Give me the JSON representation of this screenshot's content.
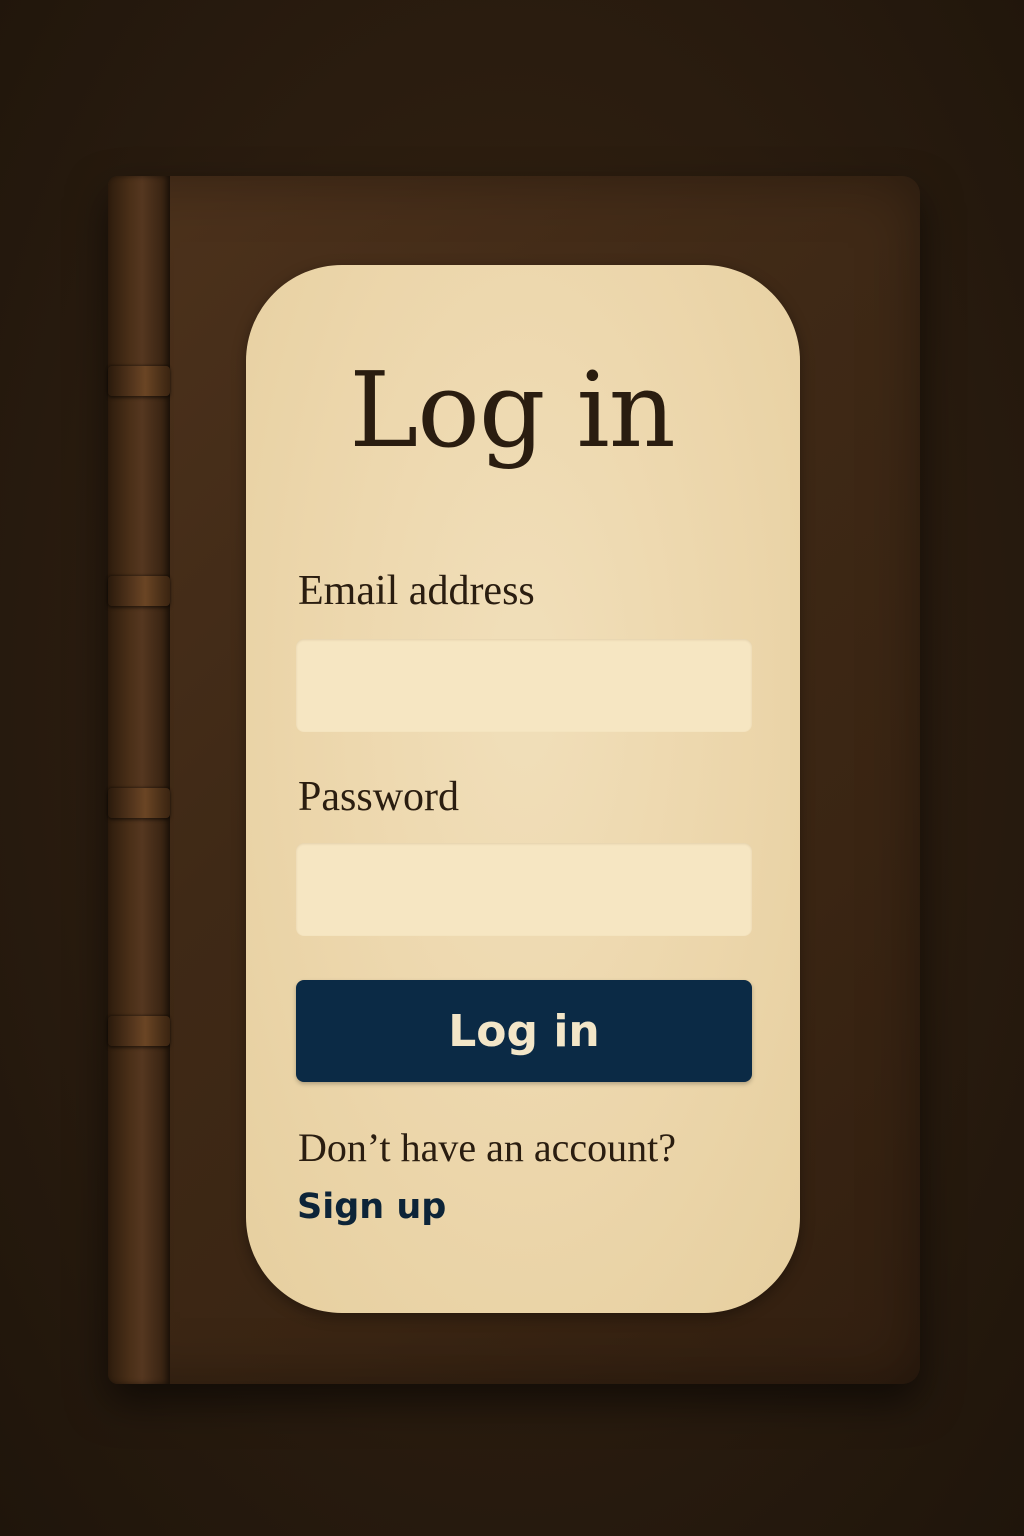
{
  "form": {
    "title": "Log in",
    "email_label": "Email address",
    "email_value": "",
    "password_label": "Password",
    "password_value": "",
    "submit_label": "Log in",
    "no_account_text": "Don’t have an account?",
    "signup_label": "Sign up"
  },
  "colors": {
    "background": "#2b1d10",
    "book_leather": "#3f2916",
    "card": "#ecd6ab",
    "input_fill": "#f6e6c2",
    "primary_button": "#0b2a45",
    "button_text": "#f3e6c8",
    "text_dark": "#2a1d10",
    "link": "#0d2438"
  }
}
